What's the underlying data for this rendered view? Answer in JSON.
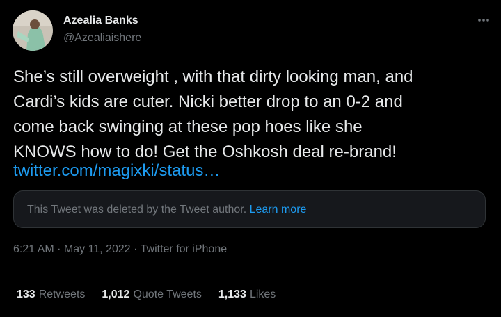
{
  "user": {
    "name": "Azealia Banks",
    "handle": "@Azealiaishere"
  },
  "tweet": {
    "text": "She’s still overweight , with that dirty looking man, and\nCardi’s kids are cuter. Nicki better drop to an 0-2 and\ncome back swinging at these pop hoes like she\nKNOWS how to do! Get the Oshkosh deal re-brand!",
    "link": "twitter.com/magixki/status…"
  },
  "quote": {
    "message": "This Tweet was deleted by the Tweet author. ",
    "link_label": "Learn more"
  },
  "meta": {
    "time": "6:21 AM",
    "sep1": " · ",
    "date": "May 11, 2022",
    "sep2": " · ",
    "source": "Twitter for iPhone"
  },
  "stats": [
    {
      "count": "133",
      "label": "Retweets"
    },
    {
      "count": "1,012",
      "label": "Quote Tweets"
    },
    {
      "count": "1,133",
      "label": "Likes"
    }
  ],
  "colors": {
    "background": "#000000",
    "text": "#e7e9ea",
    "muted": "#71767b",
    "link": "#1d9bf0"
  },
  "icons": {
    "more": "more-icon",
    "avatar": "avatar"
  }
}
